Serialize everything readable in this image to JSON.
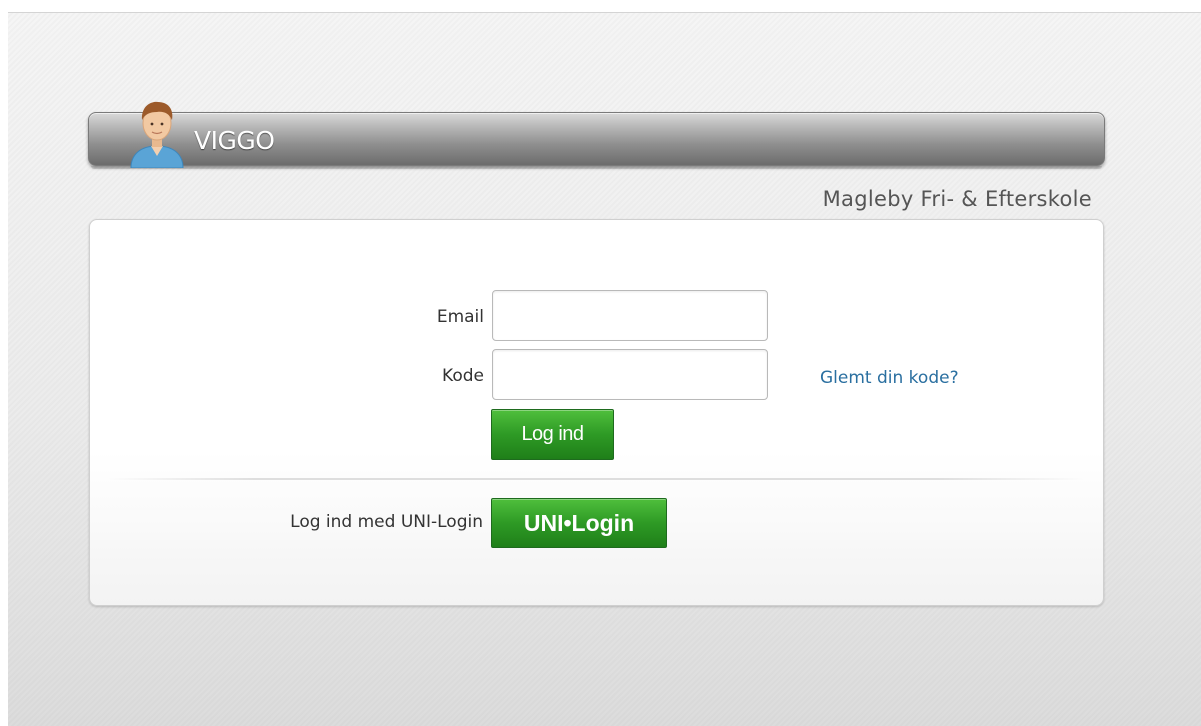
{
  "header": {
    "logo_text": "VIGGO",
    "avatar_icon": "person-avatar-icon"
  },
  "school": {
    "name": "Magleby Fri- & Efterskole"
  },
  "login_form": {
    "email_label": "Email",
    "email_value": "",
    "password_label": "Kode",
    "password_value": "",
    "forgot_link": "Glemt din kode?",
    "submit_label": "Log ind"
  },
  "uni_login": {
    "label": "Log ind med UNI-Login",
    "button_label": "UNI•Login"
  },
  "colors": {
    "button_green": "#2e9a25",
    "link_blue": "#2a6fa0",
    "header_gray": "#8f8f8f"
  }
}
